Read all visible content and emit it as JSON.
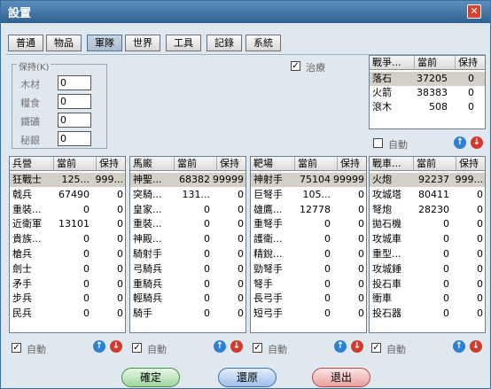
{
  "window": {
    "title": "設置",
    "close_glyph": "✕"
  },
  "tabs": [
    {
      "label": "普通"
    },
    {
      "label": "物品"
    },
    {
      "label": "軍隊"
    },
    {
      "label": "世界"
    },
    {
      "label": "工具"
    },
    {
      "label": "記錄"
    },
    {
      "label": "系統"
    }
  ],
  "keep_group": {
    "title": "保持(K)",
    "items": [
      {
        "label": "木材",
        "value": "0"
      },
      {
        "label": "糧食",
        "value": "0"
      },
      {
        "label": "鐵礦",
        "value": "0"
      },
      {
        "label": "秘銀",
        "value": "0"
      }
    ]
  },
  "heal": {
    "label": "治療",
    "checked": "✓"
  },
  "auto_label": "自動",
  "arrows": {
    "up": "↑",
    "down": "↓"
  },
  "top_panel": {
    "headers": [
      "戰爭...",
      "當前",
      "保持"
    ],
    "rows": [
      {
        "name": "落石",
        "cur": "37205",
        "keep": "0"
      },
      {
        "name": "火箭",
        "cur": "38383",
        "keep": "0"
      },
      {
        "name": "滾木",
        "cur": "508",
        "keep": "0"
      }
    ]
  },
  "panels": [
    {
      "headers": [
        "兵營",
        "當前",
        "保持"
      ],
      "rows": [
        {
          "name": "狂戰士",
          "cur": "125...",
          "keep": "999..."
        },
        {
          "name": "戟兵",
          "cur": "67490",
          "keep": "0"
        },
        {
          "name": "重裝...",
          "cur": "0",
          "keep": "0"
        },
        {
          "name": "近衛軍",
          "cur": "13101",
          "keep": "0"
        },
        {
          "name": "貴族...",
          "cur": "0",
          "keep": "0"
        },
        {
          "name": "槍兵",
          "cur": "0",
          "keep": "0"
        },
        {
          "name": "劍士",
          "cur": "0",
          "keep": "0"
        },
        {
          "name": "矛手",
          "cur": "0",
          "keep": "0"
        },
        {
          "name": "步兵",
          "cur": "0",
          "keep": "0"
        },
        {
          "name": "民兵",
          "cur": "0",
          "keep": "0"
        }
      ]
    },
    {
      "headers": [
        "馬廄",
        "當前",
        "保持"
      ],
      "rows": [
        {
          "name": "神聖...",
          "cur": "68382",
          "keep": "99999"
        },
        {
          "name": "突騎...",
          "cur": "131...",
          "keep": "0"
        },
        {
          "name": "皇家...",
          "cur": "0",
          "keep": "0"
        },
        {
          "name": "重裝...",
          "cur": "0",
          "keep": "0"
        },
        {
          "name": "神殿...",
          "cur": "0",
          "keep": "0"
        },
        {
          "name": "騎射手",
          "cur": "0",
          "keep": "0"
        },
        {
          "name": "弓騎兵",
          "cur": "0",
          "keep": "0"
        },
        {
          "name": "重騎兵",
          "cur": "0",
          "keep": "0"
        },
        {
          "name": "輕騎兵",
          "cur": "0",
          "keep": "0"
        },
        {
          "name": "騎手",
          "cur": "0",
          "keep": "0"
        }
      ]
    },
    {
      "headers": [
        "靶場",
        "當前",
        "保持"
      ],
      "rows": [
        {
          "name": "神射手",
          "cur": "75104",
          "keep": "99999"
        },
        {
          "name": "巨弩手",
          "cur": "105...",
          "keep": "0"
        },
        {
          "name": "雄鷹...",
          "cur": "12778",
          "keep": "0"
        },
        {
          "name": "重弩手",
          "cur": "0",
          "keep": "0"
        },
        {
          "name": "護衛...",
          "cur": "0",
          "keep": "0"
        },
        {
          "name": "精銳...",
          "cur": "0",
          "keep": "0"
        },
        {
          "name": "勁弩手",
          "cur": "0",
          "keep": "0"
        },
        {
          "name": "弩手",
          "cur": "0",
          "keep": "0"
        },
        {
          "name": "長弓手",
          "cur": "0",
          "keep": "0"
        },
        {
          "name": "短弓手",
          "cur": "0",
          "keep": "0"
        }
      ]
    },
    {
      "headers": [
        "戰車...",
        "當前",
        "保持"
      ],
      "rows": [
        {
          "name": "火炮",
          "cur": "92237",
          "keep": "999..."
        },
        {
          "name": "攻城塔",
          "cur": "80411",
          "keep": "0"
        },
        {
          "name": "弩炮",
          "cur": "28230",
          "keep": "0"
        },
        {
          "name": "拋石機",
          "cur": "0",
          "keep": "0"
        },
        {
          "name": "攻城車",
          "cur": "0",
          "keep": "0"
        },
        {
          "name": "重型...",
          "cur": "0",
          "keep": "0"
        },
        {
          "name": "攻城錘",
          "cur": "0",
          "keep": "0"
        },
        {
          "name": "投石車",
          "cur": "0",
          "keep": "0"
        },
        {
          "name": "衝車",
          "cur": "0",
          "keep": "0"
        },
        {
          "name": "投石器",
          "cur": "0",
          "keep": "0"
        }
      ]
    }
  ],
  "buttons": {
    "confirm": "確定",
    "restore": "還原",
    "exit": "退出"
  }
}
